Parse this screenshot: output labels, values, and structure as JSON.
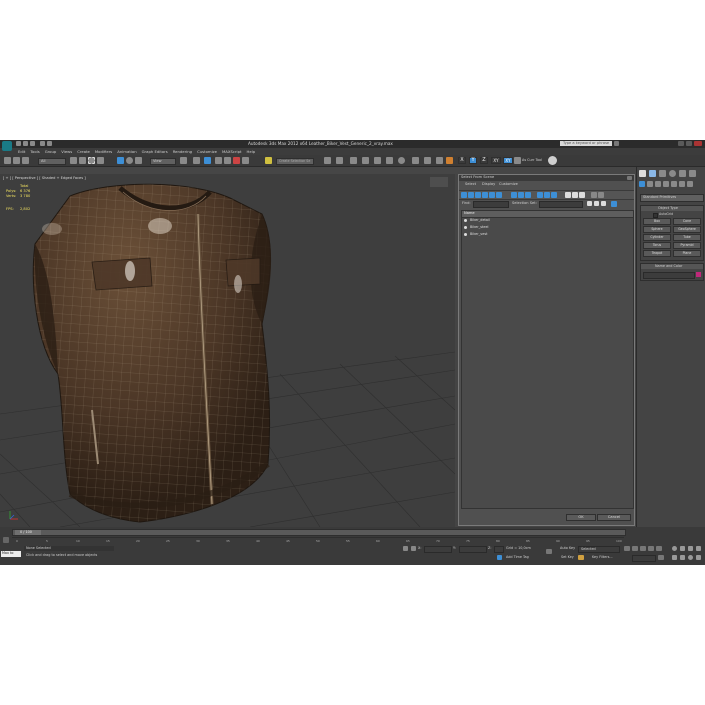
{
  "window": {
    "title": "Autodesk 3ds Max 2012 x64 Leather_Biker_Vest_Generic_2_vray.max",
    "search_placeholder": "Type a keyword or phrase"
  },
  "menu": [
    "Edit",
    "Tools",
    "Group",
    "Views",
    "Create",
    "Modifiers",
    "Animation",
    "Graph Editors",
    "Rendering",
    "Customize",
    "MAXScript",
    "Help"
  ],
  "toolbar": {
    "filter_value": "All",
    "view_value": "View",
    "selection_set_placeholder": "Create Selection Se",
    "axis_x": "X",
    "axis_y": "Y",
    "axis_z": "Z",
    "axis_xy": "XY",
    "axis_xy2": "XY",
    "use_curr_tool": "As Curr Tool"
  },
  "viewport": {
    "label": "[ + ] [ Perspective ] [ Shaded + Edged Faces ]",
    "stats": {
      "total_label": "Total",
      "polys_label": "Polys:",
      "polys_value": "6 376",
      "verts_label": "Verts:",
      "verts_value": "3 780",
      "fps_label": "FPS:",
      "fps_value": "2,802"
    }
  },
  "dialog": {
    "title": "Select From Scene",
    "menu": [
      "Select",
      "Display",
      "Customize"
    ],
    "find_label": "Find:",
    "selection_set_label": "Selection Set:",
    "column_header": "Name",
    "items": [
      "Biker_detail",
      "Biker_steel",
      "Biker_vest"
    ],
    "ok_label": "OK",
    "cancel_label": "Cancel"
  },
  "command_panel": {
    "dropdown_value": "Standard Primitives",
    "object_type_header": "Object Type",
    "autogrid_label": "AutoGrid",
    "primitives": [
      "Box",
      "Cone",
      "Sphere",
      "GeoSphere",
      "Cylinder",
      "Tube",
      "Torus",
      "Pyramid",
      "Teapot",
      "Plane"
    ],
    "name_color_header": "Name and Color",
    "color_swatch": "#c0287a"
  },
  "timeline": {
    "frame_counter": "0 / 100",
    "ticks": [
      "0",
      "5",
      "10",
      "15",
      "20",
      "25",
      "30",
      "35",
      "40",
      "45",
      "50",
      "55",
      "60",
      "65",
      "70",
      "75",
      "80",
      "85",
      "90",
      "95",
      "100"
    ]
  },
  "status": {
    "listener_label": "Max to",
    "selection_text": "None Selected",
    "prompt_text": "Click and drag to select and move objects",
    "x_label": "X:",
    "y_label": "Y:",
    "z_label": "Z:",
    "grid_text": "Grid = 10,0cm",
    "add_time_tag": "Add Time Tag",
    "auto_key": "Auto Key",
    "set_key": "Set Key",
    "selected_value": "Selected",
    "key_filters": "Key Filters..."
  },
  "colors": {
    "accent_blue": "#3d8fd6",
    "vest_brown": "#5a4130",
    "viewport_bg": "#3e3e3e",
    "swatch": "#c0287a"
  }
}
